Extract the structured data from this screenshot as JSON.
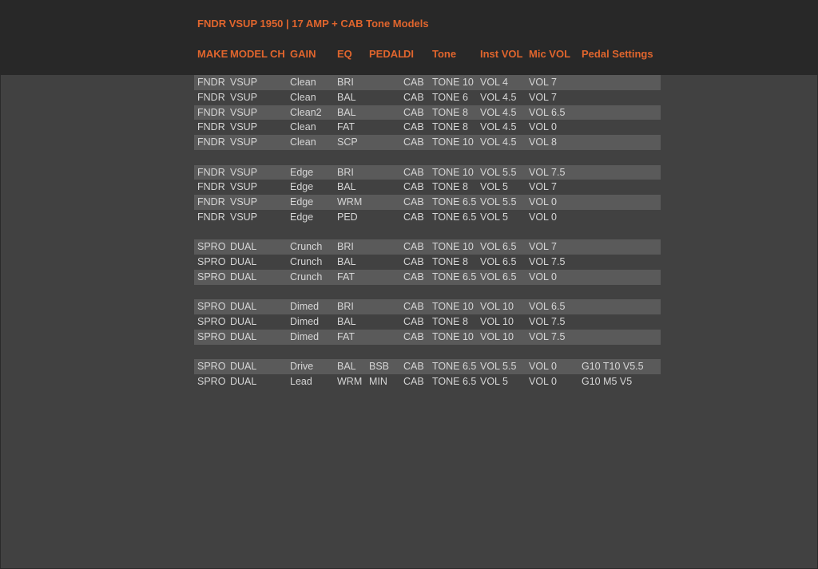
{
  "title": "FNDR VSUP 1950 | 17 AMP + CAB Tone Models",
  "columns": [
    "MAKE",
    "MODEL",
    "CH",
    "GAIN",
    "EQ",
    "PEDAL",
    "DI",
    "Tone",
    "Inst VOL",
    "Mic VOL",
    "Pedal Settings"
  ],
  "rows": [
    {
      "shaded": true,
      "cells": [
        "FNDR",
        "VSUP",
        "",
        "Clean",
        "BRI",
        "",
        "CAB",
        "TONE 10",
        "VOL 4",
        "VOL 7",
        ""
      ]
    },
    {
      "shaded": false,
      "cells": [
        "FNDR",
        "VSUP",
        "",
        "Clean",
        "BAL",
        "",
        "CAB",
        "TONE 6",
        "VOL 4.5",
        "VOL 7",
        ""
      ]
    },
    {
      "shaded": true,
      "cells": [
        "FNDR",
        "VSUP",
        "",
        "Clean2",
        "BAL",
        "",
        "CAB",
        "TONE 8",
        "VOL 4.5",
        "VOL 6.5",
        ""
      ]
    },
    {
      "shaded": false,
      "cells": [
        "FNDR",
        "VSUP",
        "",
        "Clean",
        "FAT",
        "",
        "CAB",
        "TONE 8",
        "VOL 4.5",
        "VOL 0",
        ""
      ]
    },
    {
      "shaded": true,
      "cells": [
        "FNDR",
        "VSUP",
        "",
        "Clean",
        "SCP",
        "",
        "CAB",
        "TONE 10",
        "VOL 4.5",
        "VOL 8",
        ""
      ]
    },
    {
      "shaded": false,
      "cells": [
        "",
        "",
        "",
        "",
        "",
        "",
        "",
        "",
        "",
        "",
        ""
      ]
    },
    {
      "shaded": true,
      "cells": [
        "FNDR",
        "VSUP",
        "",
        "Edge",
        "BRI",
        "",
        "CAB",
        "TONE 10",
        "VOL 5.5",
        "VOL 7.5",
        ""
      ]
    },
    {
      "shaded": false,
      "cells": [
        "FNDR",
        "VSUP",
        "",
        "Edge",
        "BAL",
        "",
        "CAB",
        "TONE 8",
        "VOL 5",
        "VOL 7",
        ""
      ]
    },
    {
      "shaded": true,
      "cells": [
        "FNDR",
        "VSUP",
        "",
        "Edge",
        "WRM",
        "",
        "CAB",
        "TONE 6.5",
        "VOL 5.5",
        "VOL 0",
        ""
      ]
    },
    {
      "shaded": false,
      "cells": [
        "FNDR",
        "VSUP",
        "",
        "Edge",
        "PED",
        "",
        "CAB",
        "TONE 6.5",
        "VOL 5",
        "VOL 0",
        ""
      ]
    },
    {
      "shaded": false,
      "cells": [
        "",
        "",
        "",
        "",
        "",
        "",
        "",
        "",
        "",
        "",
        ""
      ]
    },
    {
      "shaded": true,
      "cells": [
        "SPRO",
        "DUAL",
        "",
        "Crunch",
        "BRI",
        "",
        "CAB",
        "TONE 10",
        "VOL 6.5",
        "VOL 7",
        ""
      ]
    },
    {
      "shaded": false,
      "cells": [
        "SPRO",
        "DUAL",
        "",
        "Crunch",
        "BAL",
        "",
        "CAB",
        "TONE 8",
        "VOL 6.5",
        "VOL 7.5",
        ""
      ]
    },
    {
      "shaded": true,
      "cells": [
        "SPRO",
        "DUAL",
        "",
        "Crunch",
        "FAT",
        "",
        "CAB",
        "TONE 6.5",
        "VOL 6.5",
        "VOL 0",
        ""
      ]
    },
    {
      "shaded": false,
      "cells": [
        "",
        "",
        "",
        "",
        "",
        "",
        "",
        "",
        "",
        "",
        ""
      ]
    },
    {
      "shaded": true,
      "cells": [
        "SPRO",
        "DUAL",
        "",
        "Dimed",
        "BRI",
        "",
        "CAB",
        "TONE 10",
        "VOL 10",
        "VOL 6.5",
        ""
      ]
    },
    {
      "shaded": false,
      "cells": [
        "SPRO",
        "DUAL",
        "",
        "Dimed",
        "BAL",
        "",
        "CAB",
        "TONE 8",
        "VOL 10",
        "VOL 7.5",
        ""
      ]
    },
    {
      "shaded": true,
      "cells": [
        "SPRO",
        "DUAL",
        "",
        "Dimed",
        "FAT",
        "",
        "CAB",
        "TONE 10",
        "VOL 10",
        "VOL 7.5",
        ""
      ]
    },
    {
      "shaded": false,
      "cells": [
        "",
        "",
        "",
        "",
        "",
        "",
        "",
        "",
        "",
        "",
        ""
      ]
    },
    {
      "shaded": true,
      "cells": [
        "SPRO",
        "DUAL",
        "",
        "Drive",
        "BAL",
        "BSB",
        "CAB",
        "TONE 6.5",
        "VOL 5.5",
        "VOL 0",
        "G10 T10 V5.5"
      ]
    },
    {
      "shaded": false,
      "cells": [
        "SPRO",
        "DUAL",
        "",
        "Lead",
        "WRM",
        "MIN",
        "CAB",
        "TONE 6.5",
        "VOL 5",
        "VOL 0",
        "G10 M5 V5"
      ]
    }
  ]
}
